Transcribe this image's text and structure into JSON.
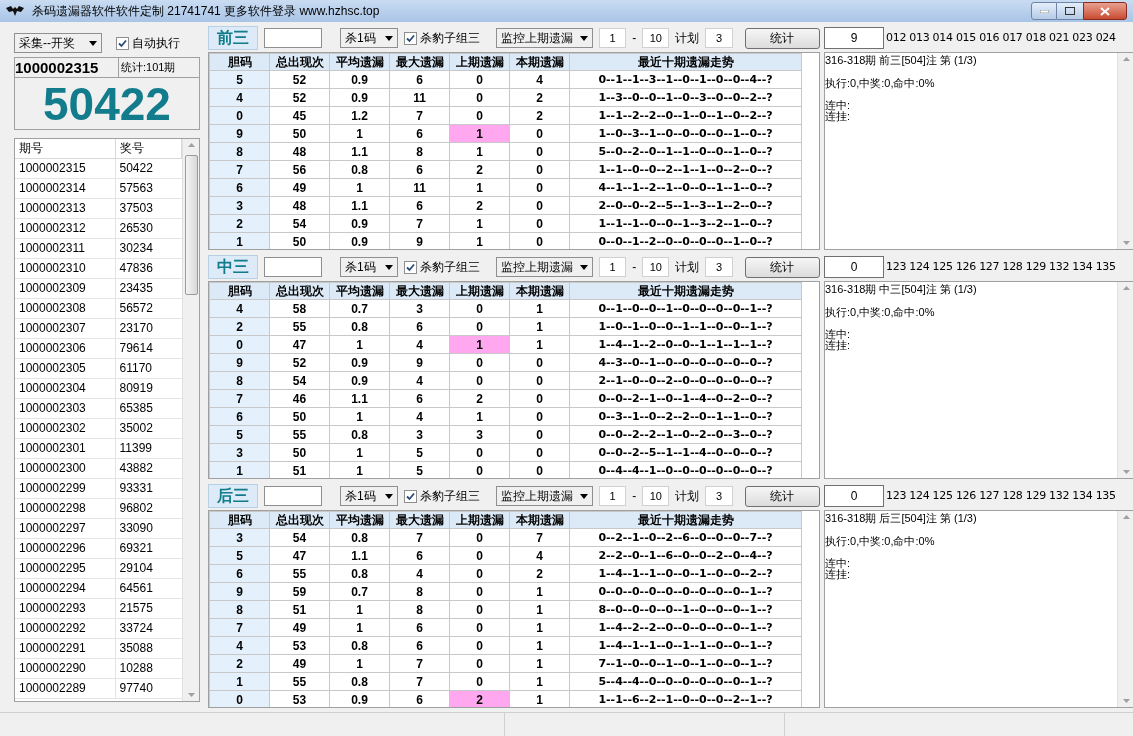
{
  "window": {
    "title": "杀码遗漏器软件软件定制 21741741 更多软件登录 www.hzhsc.top"
  },
  "left_panel": {
    "source_select": "采集--开奖",
    "auto_run": {
      "label": "自动执行",
      "checked": true
    },
    "current_issue": "1000002315",
    "stats": "统计:101期",
    "current_number": "50422",
    "draws": {
      "columns": [
        "期号",
        "奖号"
      ],
      "rows": [
        {
          "issue": "1000002315",
          "number": "50422"
        },
        {
          "issue": "1000002314",
          "number": "57563"
        },
        {
          "issue": "1000002313",
          "number": "37503"
        },
        {
          "issue": "1000002312",
          "number": "26530"
        },
        {
          "issue": "1000002311",
          "number": "30234"
        },
        {
          "issue": "1000002310",
          "number": "47836"
        },
        {
          "issue": "1000002309",
          "number": "23435"
        },
        {
          "issue": "1000002308",
          "number": "56572"
        },
        {
          "issue": "1000002307",
          "number": "23170"
        },
        {
          "issue": "1000002306",
          "number": "79614"
        },
        {
          "issue": "1000002305",
          "number": "61170"
        },
        {
          "issue": "1000002304",
          "number": "80919"
        },
        {
          "issue": "1000002303",
          "number": "65385"
        },
        {
          "issue": "1000002302",
          "number": "35002"
        },
        {
          "issue": "1000002301",
          "number": "11399"
        },
        {
          "issue": "1000002300",
          "number": "43882"
        },
        {
          "issue": "1000002299",
          "number": "93331"
        },
        {
          "issue": "1000002298",
          "number": "96802"
        },
        {
          "issue": "1000002297",
          "number": "33090"
        },
        {
          "issue": "1000002296",
          "number": "69321"
        },
        {
          "issue": "1000002295",
          "number": "29104"
        },
        {
          "issue": "1000002294",
          "number": "64561"
        },
        {
          "issue": "1000002293",
          "number": "21575"
        },
        {
          "issue": "1000002292",
          "number": "33724"
        },
        {
          "issue": "1000002291",
          "number": "35088"
        },
        {
          "issue": "1000002290",
          "number": "10288"
        },
        {
          "issue": "1000002289",
          "number": "97740"
        }
      ]
    }
  },
  "sections": [
    {
      "label": "前三",
      "kill_select": "杀1码",
      "kill_leopard": {
        "label": "杀豹子组三",
        "checked": true
      },
      "monitor_select": "监控上期遗漏",
      "range_from": "1",
      "range_separator": "-",
      "range_to": "10",
      "plan_label": "计划",
      "plan_value": "3",
      "stat_button": "统计",
      "columns": [
        "胆码",
        "总出现次",
        "平均遗漏",
        "最大遗漏",
        "上期遗漏",
        "本期遗漏",
        "最近十期遗漏走势"
      ],
      "rows": [
        {
          "code": "5",
          "total": "52",
          "avg": "0.9",
          "max": "6",
          "prev": "0",
          "prev_marked": false,
          "current": "4",
          "trend": "0--1--1--3--1--0--1--0--0--4--?"
        },
        {
          "code": "4",
          "total": "52",
          "avg": "0.9",
          "max": "11",
          "prev": "0",
          "prev_marked": false,
          "current": "2",
          "trend": "1--3--0--0--1--0--3--0--0--2--?"
        },
        {
          "code": "0",
          "total": "45",
          "avg": "1.2",
          "max": "7",
          "prev": "0",
          "prev_marked": false,
          "current": "2",
          "trend": "1--1--2--2--0--1--0--1--0--2--?"
        },
        {
          "code": "9",
          "total": "50",
          "avg": "1",
          "max": "6",
          "prev": "1",
          "prev_marked": true,
          "current": "0",
          "trend": "1--0--3--1--0--0--0--0--1--0--?"
        },
        {
          "code": "8",
          "total": "48",
          "avg": "1.1",
          "max": "8",
          "prev": "1",
          "prev_marked": false,
          "current": "0",
          "trend": "5--0--2--0--1--1--0--0--1--0--?"
        },
        {
          "code": "7",
          "total": "56",
          "avg": "0.8",
          "max": "6",
          "prev": "2",
          "prev_marked": false,
          "current": "0",
          "trend": "1--1--0--0--2--1--1--0--2--0--?"
        },
        {
          "code": "6",
          "total": "49",
          "avg": "1",
          "max": "11",
          "prev": "1",
          "prev_marked": false,
          "current": "0",
          "trend": "4--1--1--2--1--0--0--1--1--0--?"
        },
        {
          "code": "3",
          "total": "48",
          "avg": "1.1",
          "max": "6",
          "prev": "2",
          "prev_marked": false,
          "current": "0",
          "trend": "2--0--0--2--5--1--3--1--2--0--?"
        },
        {
          "code": "2",
          "total": "54",
          "avg": "0.9",
          "max": "7",
          "prev": "1",
          "prev_marked": false,
          "current": "0",
          "trend": "1--1--1--0--0--1--3--2--1--0--?"
        },
        {
          "code": "1",
          "total": "50",
          "avg": "0.9",
          "max": "9",
          "prev": "1",
          "prev_marked": false,
          "current": "0",
          "trend": "0--0--1--2--0--0--0--0--1--0--?"
        }
      ],
      "filter_value": "9",
      "combos": "012 013 014 015 016 017 018 021 023 024",
      "log": [
        "316-318期 前三[504]注 第 (1/3)",
        "执行:0,中奖:0,命中:0%"
      ],
      "streak_lines": [
        "连中:",
        "连挂:"
      ]
    },
    {
      "label": "中三",
      "kill_select": "杀1码",
      "kill_leopard": {
        "label": "杀豹子组三",
        "checked": true
      },
      "monitor_select": "监控上期遗漏",
      "range_from": "1",
      "range_separator": "-",
      "range_to": "10",
      "plan_label": "计划",
      "plan_value": "3",
      "stat_button": "统计",
      "columns": [
        "胆码",
        "总出现次",
        "平均遗漏",
        "最大遗漏",
        "上期遗漏",
        "本期遗漏",
        "最近十期遗漏走势"
      ],
      "rows": [
        {
          "code": "4",
          "total": "58",
          "avg": "0.7",
          "max": "3",
          "prev": "0",
          "prev_marked": false,
          "current": "1",
          "trend": "0--1--0--0--1--0--0--0--0--1--?"
        },
        {
          "code": "2",
          "total": "55",
          "avg": "0.8",
          "max": "6",
          "prev": "0",
          "prev_marked": false,
          "current": "1",
          "trend": "1--0--1--0--0--1--1--0--0--1--?"
        },
        {
          "code": "0",
          "total": "47",
          "avg": "1",
          "max": "4",
          "prev": "1",
          "prev_marked": true,
          "current": "1",
          "trend": "1--4--1--2--0--0--1--1--1--1--?"
        },
        {
          "code": "9",
          "total": "52",
          "avg": "0.9",
          "max": "9",
          "prev": "0",
          "prev_marked": false,
          "current": "0",
          "trend": "4--3--0--1--0--0--0--0--0--0--?"
        },
        {
          "code": "8",
          "total": "54",
          "avg": "0.9",
          "max": "4",
          "prev": "0",
          "prev_marked": false,
          "current": "0",
          "trend": "2--1--0--0--2--0--0--0--0--0--?"
        },
        {
          "code": "7",
          "total": "46",
          "avg": "1.1",
          "max": "6",
          "prev": "2",
          "prev_marked": false,
          "current": "0",
          "trend": "0--0--2--1--0--1--4--0--2--0--?"
        },
        {
          "code": "6",
          "total": "50",
          "avg": "1",
          "max": "4",
          "prev": "1",
          "prev_marked": false,
          "current": "0",
          "trend": "0--3--1--0--2--2--0--1--1--0--?"
        },
        {
          "code": "5",
          "total": "55",
          "avg": "0.8",
          "max": "3",
          "prev": "3",
          "prev_marked": false,
          "current": "0",
          "trend": "0--0--2--2--1--0--2--0--3--0--?"
        },
        {
          "code": "3",
          "total": "50",
          "avg": "1",
          "max": "5",
          "prev": "0",
          "prev_marked": false,
          "current": "0",
          "trend": "0--0--2--5--1--1--4--0--0--0--?"
        },
        {
          "code": "1",
          "total": "51",
          "avg": "1",
          "max": "5",
          "prev": "0",
          "prev_marked": false,
          "current": "0",
          "trend": "0--4--4--1--0--0--0--0--0--0--?"
        }
      ],
      "filter_value": "0",
      "combos": "123 124 125 126 127 128 129 132 134 135",
      "log": [
        "316-318期 中三[504]注 第 (1/3)",
        "执行:0,中奖:0,命中:0%"
      ],
      "streak_lines": [
        "连中:",
        "连挂:"
      ]
    },
    {
      "label": "后三",
      "kill_select": "杀1码",
      "kill_leopard": {
        "label": "杀豹子组三",
        "checked": true
      },
      "monitor_select": "监控上期遗漏",
      "range_from": "1",
      "range_separator": "-",
      "range_to": "10",
      "plan_label": "计划",
      "plan_value": "3",
      "stat_button": "统计",
      "columns": [
        "胆码",
        "总出现次",
        "平均遗漏",
        "最大遗漏",
        "上期遗漏",
        "本期遗漏",
        "最近十期遗漏走势"
      ],
      "rows": [
        {
          "code": "3",
          "total": "54",
          "avg": "0.8",
          "max": "7",
          "prev": "0",
          "prev_marked": false,
          "current": "7",
          "trend": "0--2--1--0--2--6--0--0--0--7--?"
        },
        {
          "code": "5",
          "total": "47",
          "avg": "1.1",
          "max": "6",
          "prev": "0",
          "prev_marked": false,
          "current": "4",
          "trend": "2--2--0--1--6--0--0--2--0--4--?"
        },
        {
          "code": "6",
          "total": "55",
          "avg": "0.8",
          "max": "4",
          "prev": "0",
          "prev_marked": false,
          "current": "2",
          "trend": "1--4--1--1--0--0--1--0--0--2--?"
        },
        {
          "code": "9",
          "total": "59",
          "avg": "0.7",
          "max": "8",
          "prev": "0",
          "prev_marked": false,
          "current": "1",
          "trend": "0--0--0--0--0--0--0--0--0--1--?"
        },
        {
          "code": "8",
          "total": "51",
          "avg": "1",
          "max": "8",
          "prev": "0",
          "prev_marked": false,
          "current": "1",
          "trend": "8--0--0--0--0--1--0--0--0--1--?"
        },
        {
          "code": "7",
          "total": "49",
          "avg": "1",
          "max": "6",
          "prev": "0",
          "prev_marked": false,
          "current": "1",
          "trend": "1--4--2--2--0--0--0--0--0--1--?"
        },
        {
          "code": "4",
          "total": "53",
          "avg": "0.8",
          "max": "6",
          "prev": "0",
          "prev_marked": false,
          "current": "1",
          "trend": "1--4--1--1--0--1--1--0--0--1--?"
        },
        {
          "code": "2",
          "total": "49",
          "avg": "1",
          "max": "7",
          "prev": "0",
          "prev_marked": false,
          "current": "1",
          "trend": "7--1--0--0--1--0--1--0--0--1--?"
        },
        {
          "code": "1",
          "total": "55",
          "avg": "0.8",
          "max": "7",
          "prev": "0",
          "prev_marked": false,
          "current": "1",
          "trend": "5--4--4--0--0--0--0--0--0--1--?"
        },
        {
          "code": "0",
          "total": "53",
          "avg": "0.9",
          "max": "6",
          "prev": "2",
          "prev_marked": true,
          "current": "1",
          "trend": "1--1--6--2--1--0--0--0--2--1--?"
        }
      ],
      "filter_value": "0",
      "combos": "123 124 125 126 127 128 129 132 134 135",
      "log": [
        "316-318期 后三[504]注 第 (1/3)",
        "执行:0,中奖:0,命中:0%"
      ],
      "streak_lines": [
        "连中:",
        "连挂:"
      ]
    }
  ]
}
